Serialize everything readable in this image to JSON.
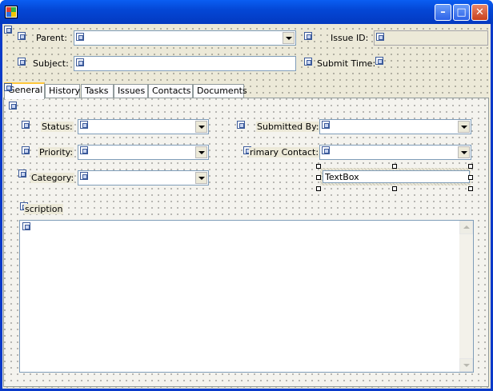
{
  "window": {
    "title": "",
    "controls": {
      "minimize": "–",
      "maximize": "□",
      "close": "✕"
    }
  },
  "header": {
    "parent_label": "Parent:",
    "parent_value": "",
    "issue_id_label": "Issue ID:",
    "issue_id_value": "",
    "subject_label": "Subject:",
    "subject_value": "",
    "submit_time_label": "Submit Time:"
  },
  "tabs": [
    {
      "label": "General",
      "active": true
    },
    {
      "label": "History"
    },
    {
      "label": "Tasks"
    },
    {
      "label": "Issues"
    },
    {
      "label": "Contacts"
    },
    {
      "label": "Documents"
    }
  ],
  "general": {
    "status_label": "Status:",
    "priority_label": "Priority:",
    "category_label": "Category:",
    "submitted_by_label": "Submitted By:",
    "primary_contact_label": "rimary Contact:",
    "textbox_value": "TextBox",
    "description_label": "scription",
    "description_value": ""
  },
  "icons": {
    "app": "windows-app-icon",
    "component": "designer-component-glyph-icon"
  },
  "colors": {
    "titlebar": "#0447d6",
    "form_background": "#ece9d8",
    "field_border": "#7f9db9",
    "active_tab_accent": "#ffc83c"
  }
}
